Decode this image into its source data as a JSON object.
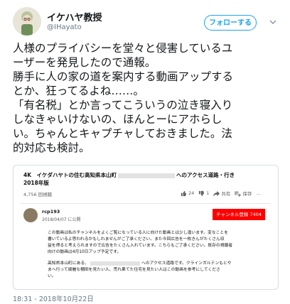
{
  "author": {
    "name": "イケハヤ教授",
    "handle": "@IHayato"
  },
  "follow_button": {
    "label": "フォローする"
  },
  "tweet": {
    "lines": [
      "人様のプライバシーを堂々と侵害しているユ",
      "ーザーを発見したので通報。",
      "勝手に人の家の道を案内する動画アップする",
      "とか、狂ってるよね……。",
      "「有名税」とか言ってこういうの泣き寝入り",
      "しなきゃいけないの、ほんとーにアホらし",
      "い。ちゃんとキャプチャしておきました。法",
      "的対応も検討。"
    ]
  },
  "embed": {
    "video": {
      "title_prefix": "4K　イケダハヤトの住む高知県本山町",
      "title_suffix": "へのアクセス道路・行き",
      "title_line2": "2018年版",
      "views": "4,756 回視聴",
      "likes": "24",
      "dislikes": "1",
      "share": "共有",
      "save": "保存",
      "more": "…"
    },
    "channel": {
      "name": "rcp193",
      "date": "2018/04/07 に公開",
      "subscribe_label": "チャンネル登録",
      "subscribe_count": "7404"
    },
    "description": {
      "lines": [
        "この動画は私のチャンネルをよくご覧になっている人に向けた動画とは少し違います。変なことを",
        "書いているよ思われるかもしれませんがご了承ください。また今回広告を一枚きんがたくさん収",
        "益を得ると考えられますので広告をたくさん入れています。こちらもご了承ください。既存の視聴者",
        "向けの動画は4月10日アップ予定です。"
      ],
      "lines2": [
        "高知県本山町にある、",
        "へのアクセス道路です。クラインガルテンもとや",
        "まへ行って綺麗な棚田を見たい人、荒れ果てた住宅を見たい人はこの動画を参考にしてくださ",
        "い。"
      ]
    }
  },
  "timestamp": "18:31 - 2018年10月22日",
  "colors": {
    "twitter_blue": "#1da1f2",
    "youtube_red": "#ff0000",
    "text": "#14171a",
    "muted": "#657786"
  }
}
